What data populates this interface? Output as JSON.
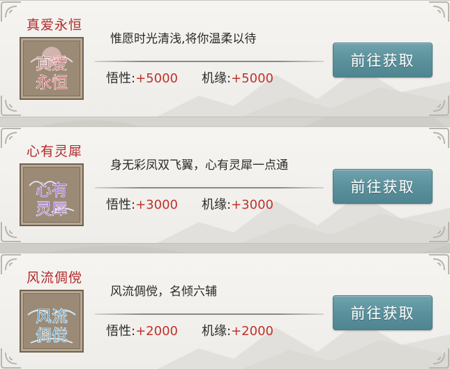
{
  "cards": [
    {
      "title": "真爱永恒",
      "description": "惟愿时光清浅,将你温柔以待",
      "stat1_label": "悟性:",
      "stat1_value": "+5000",
      "stat2_label": "机缘:",
      "stat2_value": "+5000",
      "button_label": "前往获取",
      "emblem_line1": "真爱",
      "emblem_line2": "永恒"
    },
    {
      "title": "心有灵犀",
      "description": "身无彩凤双飞翼，心有灵犀一点通",
      "stat1_label": "悟性:",
      "stat1_value": "+3000",
      "stat2_label": "机缘:",
      "stat2_value": "+3000",
      "button_label": "前往获取",
      "emblem_line1": "心有",
      "emblem_line2": "灵犀"
    },
    {
      "title": "风流倜傥",
      "description": "风流倜傥，名倾六辅",
      "stat1_label": "悟性:",
      "stat1_value": "+2000",
      "stat2_label": "机缘:",
      "stat2_value": "+2000",
      "button_label": "前往获取",
      "emblem_line1": "风流",
      "emblem_line2": "倜傥"
    }
  ],
  "colors": {
    "title_red": "#b02a2a",
    "value_red": "#c0312b",
    "button_teal": "#5b919c",
    "emblem_frame": "#9a8a76"
  }
}
